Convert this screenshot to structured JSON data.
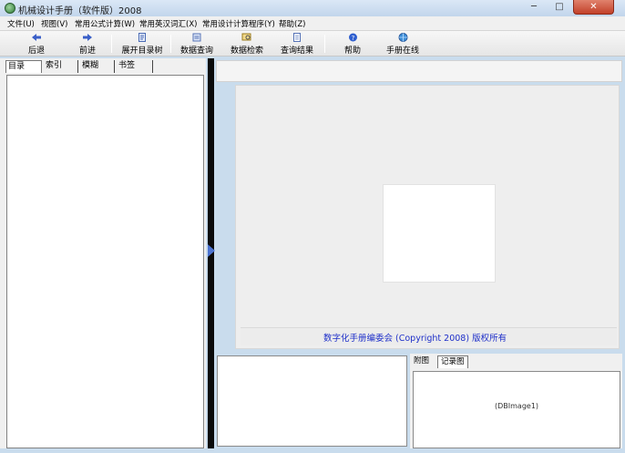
{
  "window": {
    "title": "机械设计手册（软件版）2008"
  },
  "window_controls": {
    "minimize": "─",
    "maximize": "□",
    "close": "✕"
  },
  "menu": [
    "文件(U)",
    "视图(V)",
    "常用公式计算(W)",
    "常用英汉词汇(X)",
    "常用设计计算程序(Y)",
    "帮助(Z)"
  ],
  "toolbar": {
    "back": {
      "label": "后退",
      "icon": "back-arrow-icon"
    },
    "forward": {
      "label": "前进",
      "icon": "forward-arrow-icon"
    },
    "expand_tree": {
      "label": "展开目录树",
      "icon": "document-icon"
    },
    "data_query": {
      "label": "数据查询",
      "icon": "database-icon"
    },
    "data_search": {
      "label": "数据检索",
      "icon": "search-icon"
    },
    "query_results": {
      "label": "查询结果",
      "icon": "results-icon"
    },
    "help": {
      "label": "帮助",
      "icon": "help-icon"
    },
    "manual_online": {
      "label": "手册在线",
      "icon": "globe-icon"
    }
  },
  "left_tabs": [
    "目录",
    "索引",
    "模糊",
    "书签"
  ],
  "copyright": "数字化手册编委会 (Copyright 2008) 版权所有",
  "bottom_tabs": [
    "附图",
    "记录图"
  ],
  "image_placeholder": "(DBImage1)",
  "colors": {
    "link_blue": "#1f30c9",
    "window_frame": "#c9dced",
    "splitter": "#0a0a0a"
  }
}
